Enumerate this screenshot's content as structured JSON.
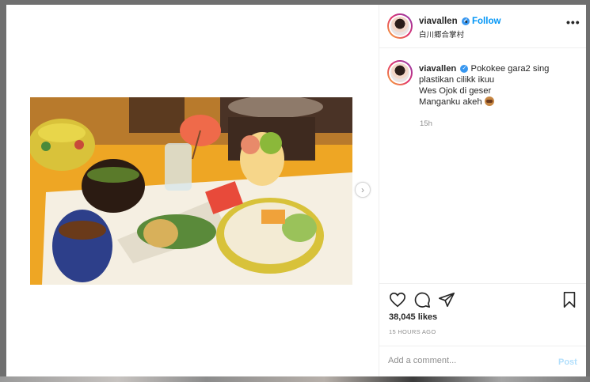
{
  "post": {
    "username": "viavallen",
    "dot": "•",
    "follow_label": "Follow",
    "location": "白川郷合掌村",
    "more_label": "•••",
    "caption": {
      "username": "viavallen",
      "line1": "Pokokee gara2 sing",
      "line2": "plastikan cilikk ikuu",
      "line3": "Wes Ojok di geser",
      "line4": "Manganku akeh",
      "emoji": "see-no-evil-monkey"
    },
    "caption_time": "15h",
    "likes": "38,045 likes",
    "posted_ago": "15 HOURS AGO",
    "comment_placeholder": "Add a comment...",
    "post_label": "Post",
    "verified_mark": "✓",
    "next_arrow": "›"
  },
  "icons": {
    "like": "heart-icon",
    "comment": "comment-icon",
    "share": "share-icon",
    "save": "bookmark-icon",
    "next": "chevron-right-icon"
  },
  "colors": {
    "accent": "#0095f6",
    "post_disabled": "#b2dffc",
    "backdrop": "#6f6f6f"
  }
}
